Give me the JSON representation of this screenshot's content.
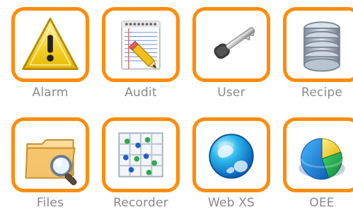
{
  "tiles": [
    {
      "label": "Alarm",
      "icon": "warning-icon"
    },
    {
      "label": "Audit",
      "icon": "notepad-pencil-icon"
    },
    {
      "label": "User",
      "icon": "key-icon"
    },
    {
      "label": "Recipe",
      "icon": "database-icon"
    },
    {
      "label": "Files",
      "icon": "folder-search-icon"
    },
    {
      "label": "Recorder",
      "icon": "scatter-grid-icon"
    },
    {
      "label": "Web XS",
      "icon": "globe-icon"
    },
    {
      "label": "OEE",
      "icon": "pie-chart-icon"
    }
  ],
  "colors": {
    "accent": "#ff8c0a",
    "label": "#8a8a8a",
    "background": "#ffffff"
  }
}
